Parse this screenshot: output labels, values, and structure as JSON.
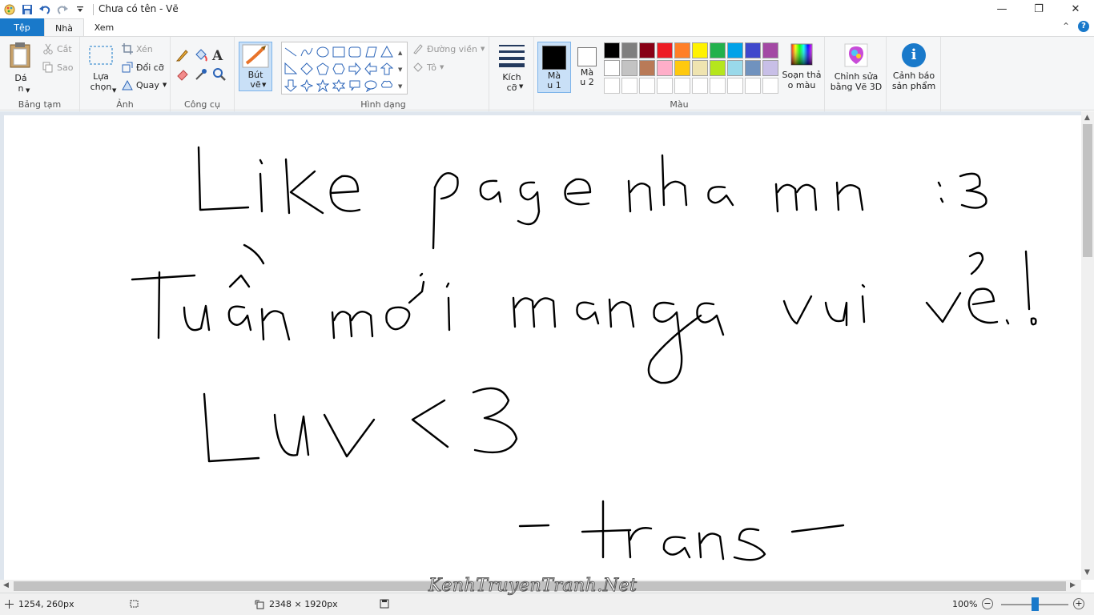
{
  "window": {
    "title": "Chưa có tên - Vẽ",
    "minimize_glyph": "—",
    "maximize_glyph": "❐",
    "close_glyph": "✕"
  },
  "tabs": {
    "file": "Tệp",
    "home": "Nhà",
    "view": "Xem",
    "collapse_glyph": "⌃",
    "help_glyph": "?"
  },
  "ribbon": {
    "clipboard": {
      "label": "Bảng tạm",
      "paste": "Dá\nn",
      "cut": "Cắt",
      "copy": "Sao"
    },
    "image": {
      "label": "Ảnh",
      "select": "Lựa\nchọn",
      "crop": "Xén",
      "resize": "Đổi cỡ",
      "rotate": "Quay"
    },
    "tools": {
      "label": "Công cụ",
      "text_glyph": "A"
    },
    "brushes": {
      "label": "Bút\nvẽ"
    },
    "shapes": {
      "label": "Hình dạng",
      "outline": "Đường viền",
      "fill": "Tô"
    },
    "size": {
      "label": "Kích\ncỡ"
    },
    "colors": {
      "label": "Màu",
      "color1": "Mà\nu 1",
      "color2": "Mà\nu 2",
      "edit_colors": "Soạn thả\no màu",
      "color1_value": "#000000",
      "color2_value": "#ffffff",
      "palette": [
        "#000000",
        "#7f7f7f",
        "#880015",
        "#ed1c24",
        "#ff7f27",
        "#fff200",
        "#22b14c",
        "#00a2e8",
        "#3f48cc",
        "#a349a4",
        "#ffffff",
        "#c3c3c3",
        "#b97a57",
        "#ffaec9",
        "#ffc90e",
        "#efe4b0",
        "#b5e61d",
        "#99d9ea",
        "#7092be",
        "#c8bfe7",
        "#ffffff",
        "#ffffff",
        "#ffffff",
        "#ffffff",
        "#ffffff",
        "#ffffff",
        "#ffffff",
        "#ffffff",
        "#ffffff",
        "#ffffff"
      ]
    },
    "paint3d": {
      "label": "Chỉnh sửa\nbằng Vẽ 3D"
    },
    "product_alert": {
      "label": "Cảnh báo\nsản phẩm",
      "glyph": "i"
    }
  },
  "status": {
    "cursor_pos": "1254, 260px",
    "canvas_size": "2348 × 1920px",
    "zoom": "100%",
    "zoom_out_glyph": "−",
    "zoom_in_glyph": "+"
  },
  "watermark": "KenhTruyenTranh.Net"
}
